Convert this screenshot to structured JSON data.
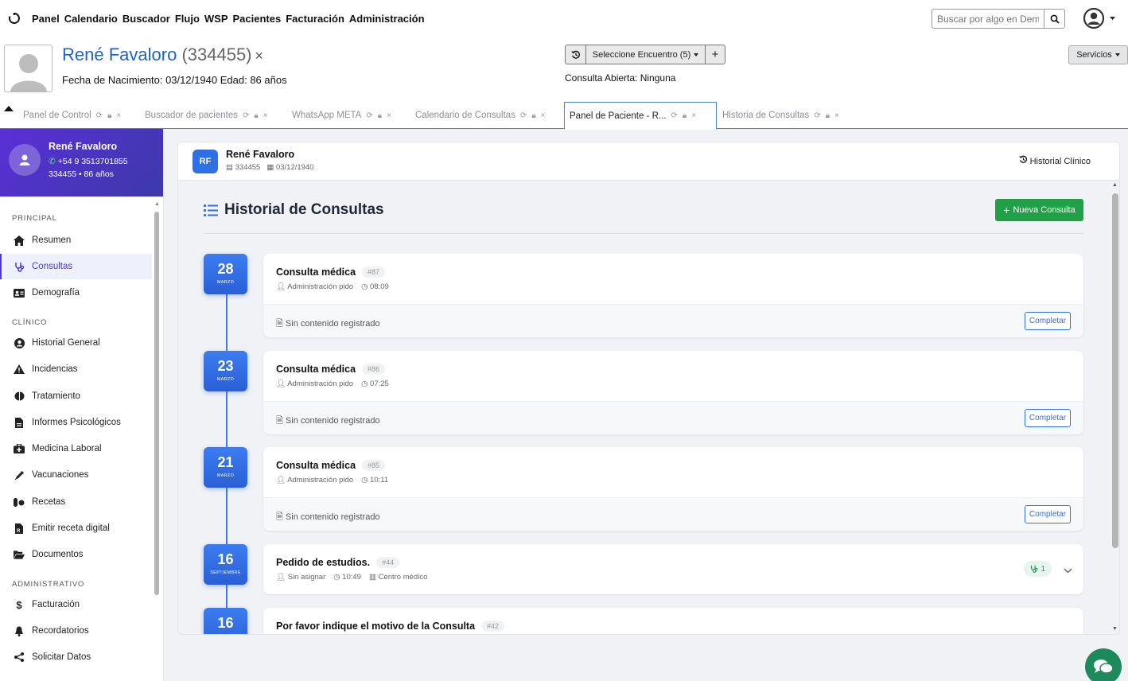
{
  "nav": {
    "menu": [
      "Panel",
      "Calendario",
      "Buscador",
      "Flujo",
      "WSP",
      "Pacientes",
      "Facturación",
      "Administración"
    ],
    "search_placeholder": "Buscar por algo en Demo"
  },
  "patient": {
    "name": "René Favaloro",
    "id_display": "(334455)",
    "close": "×",
    "dob_line": "Fecha de Nacimiento: 03/12/1940 Edad: 86 años",
    "encounter_label": "Seleccione Encuentro (5)",
    "open_consult": "Consulta Abierta: Ninguna",
    "services_label": "Servicios"
  },
  "tabs": [
    {
      "label": "Panel de Control",
      "active": false
    },
    {
      "label": "Buscador de pacientes",
      "active": false
    },
    {
      "label": "WhatsApp META",
      "active": false
    },
    {
      "label": "Calendario de Consultas",
      "active": false
    },
    {
      "label": "Panel de Paciente - R...",
      "active": true
    },
    {
      "label": "Historia de Consultas",
      "active": false
    }
  ],
  "sidebar": {
    "name": "René Favaloro",
    "phone": "+54 9 3513701855",
    "info": "334455 • 86 años",
    "sections": {
      "principal": "PRINCIPAL",
      "clinico": "CLÍNICO",
      "administrativo": "ADMINISTRATIVO"
    },
    "items": [
      {
        "label": "Resumen",
        "icon": "home-icon"
      },
      {
        "label": "Consultas",
        "icon": "stethoscope-icon",
        "active": true
      },
      {
        "label": "Demografía",
        "icon": "id-card-icon"
      },
      {
        "label": "Historial General",
        "icon": "user-circle-icon"
      },
      {
        "label": "Incidencias",
        "icon": "warning-icon"
      },
      {
        "label": "Tratamiento",
        "icon": "brain-icon"
      },
      {
        "label": "Informes Psicológicos",
        "icon": "file-icon"
      },
      {
        "label": "Medicina Laboral",
        "icon": "medkit-icon"
      },
      {
        "label": "Vacunaciones",
        "icon": "syringe-icon"
      },
      {
        "label": "Recetas",
        "icon": "pills-icon"
      },
      {
        "label": "Emitir receta digital",
        "icon": "file-prescription-icon"
      },
      {
        "label": "Documentos",
        "icon": "folder-icon"
      },
      {
        "label": "Facturación",
        "icon": "dollar-icon"
      },
      {
        "label": "Recordatorios",
        "icon": "bell-icon"
      },
      {
        "label": "Solicitar Datos",
        "icon": "share-icon"
      }
    ]
  },
  "main": {
    "badge": "RF",
    "name": "René Favaloro",
    "id": "334455",
    "dob": "03/12/1940",
    "history_link": "Historial Clínico",
    "title": "Historial de Consultas",
    "new_button": "Nueva Consulta",
    "empty_text": "Sin contenido registrado",
    "complete_label": "Completar",
    "consultations": [
      {
        "day": "28",
        "month": "MARZO",
        "title": "Consulta médica",
        "num": "#87",
        "author": "Administración pido",
        "time": "08:09"
      },
      {
        "day": "23",
        "month": "MARZO",
        "title": "Consulta médica",
        "num": "#86",
        "author": "Administración pido",
        "time": "07:25"
      },
      {
        "day": "21",
        "month": "MARZO",
        "title": "Consulta médica",
        "num": "#85",
        "author": "Administración pido",
        "time": "10:11"
      },
      {
        "day": "16",
        "month": "SEPTIEMBRE",
        "title": "Pedido de estudios.",
        "num": "#44",
        "author": "Sin asignar",
        "time": "10:49",
        "place": "Centro médico",
        "pill": "1"
      },
      {
        "day": "16",
        "month": "",
        "title": "Por favor indique el motivo de la Consulta",
        "num": "#42"
      }
    ]
  }
}
